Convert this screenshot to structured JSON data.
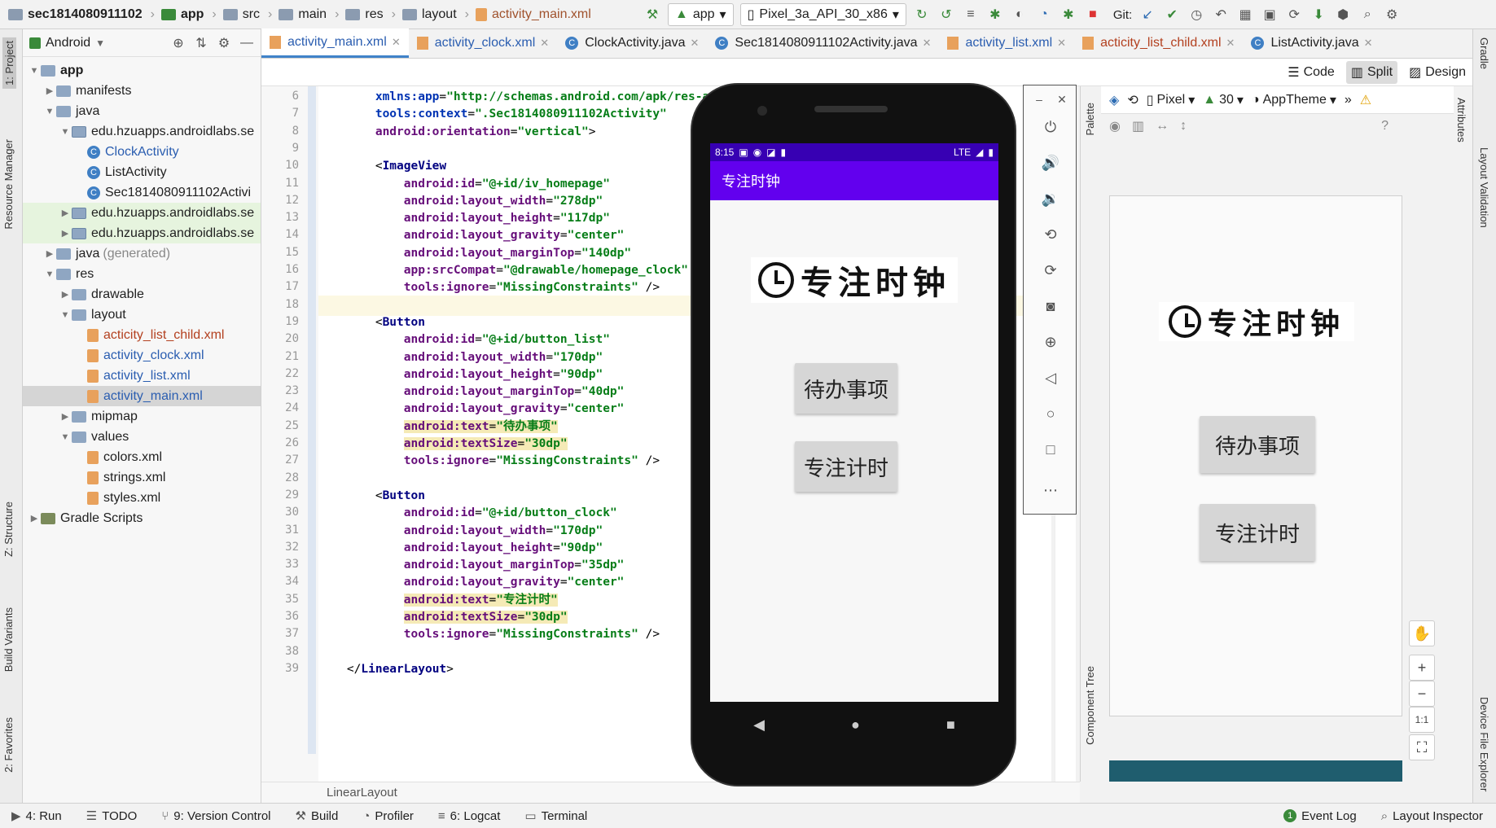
{
  "breadcrumb": [
    "sec1814080911102",
    "app",
    "src",
    "main",
    "res",
    "layout",
    "activity_main.xml"
  ],
  "toolbar": {
    "run_config": "app",
    "device": "Pixel_3a_API_30_x86",
    "git_label": "Git:"
  },
  "project_panel": {
    "title": "Android",
    "tree": [
      {
        "label": "app",
        "level": 0,
        "type": "folder",
        "open": true
      },
      {
        "label": "manifests",
        "level": 1,
        "type": "folder"
      },
      {
        "label": "java",
        "level": 1,
        "type": "folder",
        "open": true
      },
      {
        "label": "edu.hzuapps.androidlabs.se",
        "level": 2,
        "type": "pkg",
        "open": true
      },
      {
        "label": "ClockActivity",
        "level": 3,
        "type": "class",
        "blue": true
      },
      {
        "label": "ListActivity",
        "level": 3,
        "type": "class"
      },
      {
        "label": "Sec1814080911102Activi",
        "level": 3,
        "type": "class"
      },
      {
        "label": "edu.hzuapps.androidlabs.se",
        "level": 2,
        "type": "pkg",
        "green": true
      },
      {
        "label": "edu.hzuapps.androidlabs.se",
        "level": 2,
        "type": "pkg",
        "green": true
      },
      {
        "label": "java",
        "extra": "(generated)",
        "level": 1,
        "type": "folder"
      },
      {
        "label": "res",
        "level": 1,
        "type": "folder",
        "open": true
      },
      {
        "label": "drawable",
        "level": 2,
        "type": "folder"
      },
      {
        "label": "layout",
        "level": 2,
        "type": "folder",
        "open": true
      },
      {
        "label": "acticity_list_child.xml",
        "level": 3,
        "type": "xml",
        "red": true
      },
      {
        "label": "activity_clock.xml",
        "level": 3,
        "type": "xml",
        "blue": true
      },
      {
        "label": "activity_list.xml",
        "level": 3,
        "type": "xml",
        "blue": true
      },
      {
        "label": "activity_main.xml",
        "level": 3,
        "type": "xml",
        "blue": true,
        "selected": true
      },
      {
        "label": "mipmap",
        "level": 2,
        "type": "folder"
      },
      {
        "label": "values",
        "level": 2,
        "type": "folder",
        "open": true
      },
      {
        "label": "colors.xml",
        "level": 3,
        "type": "xml"
      },
      {
        "label": "strings.xml",
        "level": 3,
        "type": "xml"
      },
      {
        "label": "styles.xml",
        "level": 3,
        "type": "xml"
      },
      {
        "label": "Gradle Scripts",
        "level": 0,
        "type": "gradle"
      }
    ]
  },
  "left_tabs": [
    "1: Project",
    "Resource Manager",
    "Z: Structure",
    "Build Variants",
    "2: Favorites"
  ],
  "right_tabs": [
    "Gradle",
    "Layout Validation",
    "Device File Explorer"
  ],
  "editor_tabs": [
    {
      "label": "activity_main.xml",
      "type": "xml",
      "active": true
    },
    {
      "label": "activity_clock.xml",
      "type": "xml"
    },
    {
      "label": "ClockActivity.java",
      "type": "class"
    },
    {
      "label": "Sec1814080911102Activity.java",
      "type": "class"
    },
    {
      "label": "activity_list.xml",
      "type": "xml"
    },
    {
      "label": "acticity_list_child.xml",
      "type": "xml",
      "red": true
    },
    {
      "label": "ListActivity.java",
      "type": "class"
    }
  ],
  "view_modes": {
    "code": "Code",
    "split": "Split",
    "design": "Design"
  },
  "code_lines": [
    {
      "n": "6",
      "parts": [
        [
          "",
          "        "
        ],
        [
          "ns",
          "xmlns:app"
        ],
        [
          "",
          "="
        ],
        [
          "str",
          "\"http://schemas.android.com/apk/res-au"
        ]
      ]
    },
    {
      "n": "7",
      "parts": [
        [
          "",
          "        "
        ],
        [
          "ns",
          "tools:context"
        ],
        [
          "",
          "="
        ],
        [
          "str",
          "\".Sec1814080911102Activity\""
        ]
      ]
    },
    {
      "n": "8",
      "parts": [
        [
          "",
          "        "
        ],
        [
          "attr",
          "android:orientation"
        ],
        [
          "",
          "="
        ],
        [
          "str",
          "\"vertical\""
        ],
        [
          "",
          ">"
        ]
      ]
    },
    {
      "n": "9",
      "parts": []
    },
    {
      "n": "10",
      "parts": [
        [
          "",
          "        <"
        ],
        [
          "tag",
          "ImageView"
        ]
      ]
    },
    {
      "n": "11",
      "parts": [
        [
          "",
          "            "
        ],
        [
          "attr",
          "android:id"
        ],
        [
          "",
          "="
        ],
        [
          "str",
          "\"@+id/iv_homepage\""
        ]
      ]
    },
    {
      "n": "12",
      "parts": [
        [
          "",
          "            "
        ],
        [
          "attr",
          "android:layout_width"
        ],
        [
          "",
          "="
        ],
        [
          "str",
          "\"278dp\""
        ]
      ]
    },
    {
      "n": "13",
      "parts": [
        [
          "",
          "            "
        ],
        [
          "attr",
          "android:layout_height"
        ],
        [
          "",
          "="
        ],
        [
          "str",
          "\"117dp\""
        ]
      ]
    },
    {
      "n": "14",
      "parts": [
        [
          "",
          "            "
        ],
        [
          "attr",
          "android:layout_gravity"
        ],
        [
          "",
          "="
        ],
        [
          "str",
          "\"center\""
        ]
      ]
    },
    {
      "n": "15",
      "parts": [
        [
          "",
          "            "
        ],
        [
          "attr",
          "android:layout_marginTop"
        ],
        [
          "",
          "="
        ],
        [
          "str",
          "\"140dp\""
        ]
      ]
    },
    {
      "n": "16",
      "parts": [
        [
          "",
          "            "
        ],
        [
          "attr",
          "app:srcCompat"
        ],
        [
          "",
          "="
        ],
        [
          "str",
          "\"@drawable/homepage_clock\""
        ]
      ]
    },
    {
      "n": "17",
      "parts": [
        [
          "",
          "            "
        ],
        [
          "attr",
          "tools:ignore"
        ],
        [
          "",
          "="
        ],
        [
          "str",
          "\"MissingConstraints\""
        ],
        [
          "",
          " />"
        ]
      ]
    },
    {
      "n": "18",
      "parts": []
    },
    {
      "n": "19",
      "parts": [
        [
          "",
          "        <"
        ],
        [
          "tag",
          "Button"
        ]
      ]
    },
    {
      "n": "20",
      "parts": [
        [
          "",
          "            "
        ],
        [
          "attr",
          "android:id"
        ],
        [
          "",
          "="
        ],
        [
          "str",
          "\"@+id/button_list\""
        ]
      ]
    },
    {
      "n": "21",
      "parts": [
        [
          "",
          "            "
        ],
        [
          "attr",
          "android:layout_width"
        ],
        [
          "",
          "="
        ],
        [
          "str",
          "\"170dp\""
        ]
      ]
    },
    {
      "n": "22",
      "parts": [
        [
          "",
          "            "
        ],
        [
          "attr",
          "android:layout_height"
        ],
        [
          "",
          "="
        ],
        [
          "str",
          "\"90dp\""
        ]
      ]
    },
    {
      "n": "23",
      "parts": [
        [
          "",
          "            "
        ],
        [
          "attr",
          "android:layout_marginTop"
        ],
        [
          "",
          "="
        ],
        [
          "str",
          "\"40dp\""
        ]
      ]
    },
    {
      "n": "24",
      "parts": [
        [
          "",
          "            "
        ],
        [
          "attr",
          "android:layout_gravity"
        ],
        [
          "",
          "="
        ],
        [
          "str",
          "\"center\""
        ]
      ]
    },
    {
      "n": "25",
      "parts": [
        [
          "",
          "            "
        ],
        [
          "attrhl",
          "android:text"
        ],
        [
          "hl",
          "="
        ],
        [
          "strhl",
          "\"待办事项\""
        ]
      ]
    },
    {
      "n": "26",
      "parts": [
        [
          "",
          "            "
        ],
        [
          "attrhl",
          "android:textSize"
        ],
        [
          "hl",
          "="
        ],
        [
          "strhl",
          "\"30dp\""
        ]
      ]
    },
    {
      "n": "27",
      "parts": [
        [
          "",
          "            "
        ],
        [
          "attr",
          "tools:ignore"
        ],
        [
          "",
          "="
        ],
        [
          "str",
          "\"MissingConstraints\""
        ],
        [
          "",
          " />"
        ]
      ]
    },
    {
      "n": "28",
      "parts": []
    },
    {
      "n": "29",
      "parts": [
        [
          "",
          "        <"
        ],
        [
          "tag",
          "Button"
        ]
      ]
    },
    {
      "n": "30",
      "parts": [
        [
          "",
          "            "
        ],
        [
          "attr",
          "android:id"
        ],
        [
          "",
          "="
        ],
        [
          "str",
          "\"@+id/button_clock\""
        ]
      ]
    },
    {
      "n": "31",
      "parts": [
        [
          "",
          "            "
        ],
        [
          "attr",
          "android:layout_width"
        ],
        [
          "",
          "="
        ],
        [
          "str",
          "\"170dp\""
        ]
      ]
    },
    {
      "n": "32",
      "parts": [
        [
          "",
          "            "
        ],
        [
          "attr",
          "android:layout_height"
        ],
        [
          "",
          "="
        ],
        [
          "str",
          "\"90dp\""
        ]
      ]
    },
    {
      "n": "33",
      "parts": [
        [
          "",
          "            "
        ],
        [
          "attr",
          "android:layout_marginTop"
        ],
        [
          "",
          "="
        ],
        [
          "str",
          "\"35dp\""
        ]
      ]
    },
    {
      "n": "34",
      "parts": [
        [
          "",
          "            "
        ],
        [
          "attr",
          "android:layout_gravity"
        ],
        [
          "",
          "="
        ],
        [
          "str",
          "\"center\""
        ]
      ]
    },
    {
      "n": "35",
      "parts": [
        [
          "",
          "            "
        ],
        [
          "attrhl",
          "android:text"
        ],
        [
          "hl",
          "="
        ],
        [
          "strhl",
          "\"专注计时\""
        ]
      ]
    },
    {
      "n": "36",
      "parts": [
        [
          "",
          "            "
        ],
        [
          "attrhl",
          "android:textSize"
        ],
        [
          "hl",
          "="
        ],
        [
          "strhl",
          "\"30dp\""
        ]
      ]
    },
    {
      "n": "37",
      "parts": [
        [
          "",
          "            "
        ],
        [
          "attr",
          "tools:ignore"
        ],
        [
          "",
          "="
        ],
        [
          "str",
          "\"MissingConstraints\""
        ],
        [
          "",
          " />"
        ]
      ]
    },
    {
      "n": "38",
      "parts": []
    },
    {
      "n": "39",
      "parts": [
        [
          "",
          "    </"
        ],
        [
          "tag",
          "LinearLayout"
        ],
        [
          "",
          ">"
        ]
      ]
    }
  ],
  "code_footer": "LinearLayout",
  "phone": {
    "time": "8:15",
    "network": "LTE",
    "app_title": "专注时钟",
    "logo_text": "专注时钟",
    "button_list": "待办事项",
    "button_clock": "专注计时"
  },
  "design_toolbar": {
    "device": "Pixel",
    "api": "30",
    "theme": "AppTheme"
  },
  "side_labels": {
    "palette": "Palette",
    "component_tree": "Component Tree",
    "attributes": "Attributes"
  },
  "zoom": {
    "fit": "1:1"
  },
  "status_items": [
    {
      "label": "4: Run",
      "icon": "run-icon"
    },
    {
      "label": "TODO",
      "icon": "todo-icon"
    },
    {
      "label": "9: Version Control",
      "icon": "vcs-icon"
    },
    {
      "label": "Build",
      "icon": "build-icon"
    },
    {
      "label": "Profiler",
      "icon": "profiler-icon"
    },
    {
      "label": "6: Logcat",
      "icon": "logcat-icon"
    },
    {
      "label": "Terminal",
      "icon": "terminal-icon"
    }
  ],
  "status_right": [
    {
      "label": "Event Log",
      "badge": "1"
    },
    {
      "label": "Layout Inspector"
    }
  ],
  "colors": {
    "status_bar": "#3700b3",
    "app_bar": "#6200ee",
    "accent": "#4083c9"
  }
}
